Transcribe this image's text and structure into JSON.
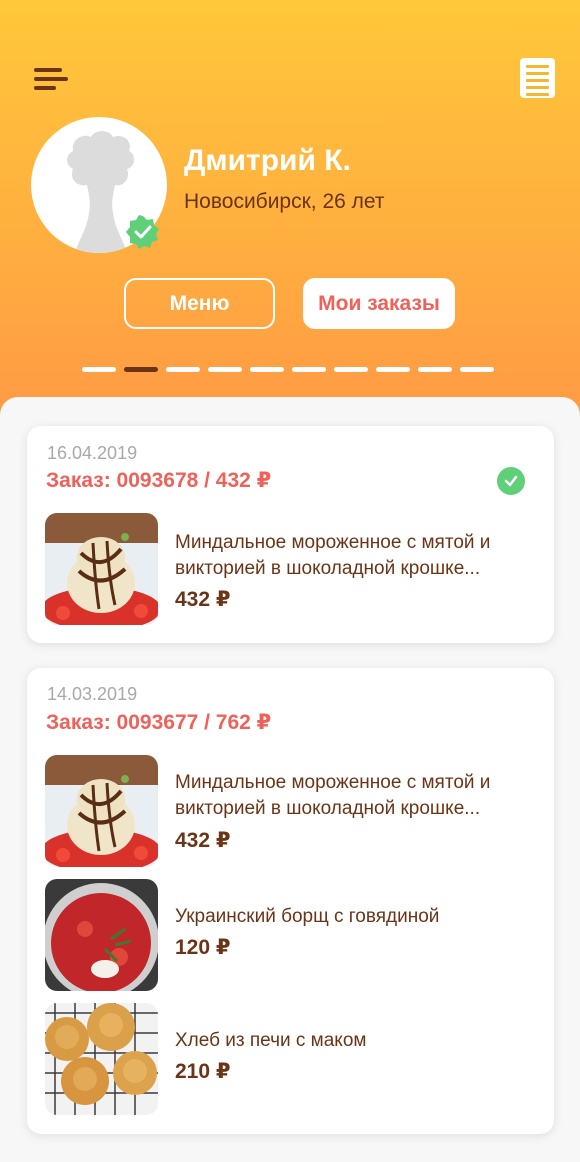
{
  "header": {
    "menu_icon": "hamburger-menu-icon",
    "receipt_icon": "document-list-icon",
    "colors": {
      "gradient_top": "#ffc83a",
      "gradient_bottom": "#ff9a45",
      "brown": "#6b3417",
      "accent": "#f0615a"
    }
  },
  "profile": {
    "name": "Дмитрий К.",
    "subtitle": "Новосибирск, 26 лет",
    "verified_icon": "verified-badge-icon"
  },
  "tabs": {
    "menu_label": "Меню",
    "orders_label": "Мои заказы",
    "active": "orders"
  },
  "pager": {
    "count": 10,
    "active_index": 1
  },
  "orders": [
    {
      "date": "16.04.2019",
      "title": "Заказ: 0093678 / 432 ₽",
      "status": "completed",
      "items": [
        {
          "name": "Миндальное мороженное с мятой и викторией в шоколадной крошке...",
          "price": "432 ₽",
          "image": "ice-cream"
        }
      ]
    },
    {
      "date": "14.03.2019",
      "title": "Заказ: 0093677 / 762 ₽",
      "status": "none",
      "items": [
        {
          "name": "Миндальное мороженное с мятой и викторией в шоколадной крошке...",
          "price": "432 ₽",
          "image": "ice-cream"
        },
        {
          "name": "Украинский борщ с говядиной",
          "price": "120 ₽",
          "image": "borscht"
        },
        {
          "name": "Хлеб из печи с маком",
          "price": "210 ₽",
          "image": "bread"
        }
      ]
    }
  ]
}
